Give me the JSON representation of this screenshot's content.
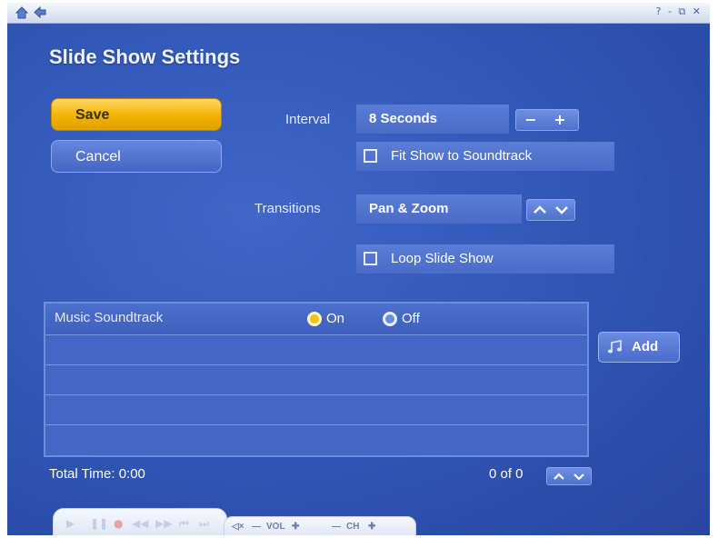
{
  "page": {
    "title": "Slide Show Settings"
  },
  "topbar": {
    "window_controls": "? - ⧉ ✕"
  },
  "actions": {
    "save_label": "Save",
    "cancel_label": "Cancel"
  },
  "interval": {
    "label": "Interval",
    "value": "8 Seconds",
    "minus": "−",
    "plus": "+"
  },
  "fit_show": {
    "label": "Fit Show to Soundtrack",
    "checked": false
  },
  "transitions": {
    "label": "Transitions",
    "value": "Pan & Zoom"
  },
  "loop_show": {
    "label": "Loop Slide Show",
    "checked": false
  },
  "music": {
    "header": "Music Soundtrack",
    "on_label": "On",
    "off_label": "Off",
    "selected": "Off",
    "rows": [
      "",
      "",
      "",
      ""
    ],
    "add_label": "Add"
  },
  "footer": {
    "total_time": "Total Time: 0:00",
    "count": "0 of 0"
  },
  "volume": {
    "vol_label": "VOL",
    "ch_label": "CH"
  },
  "colors": {
    "accent": "#f2b200",
    "panel": "#3258b8"
  }
}
